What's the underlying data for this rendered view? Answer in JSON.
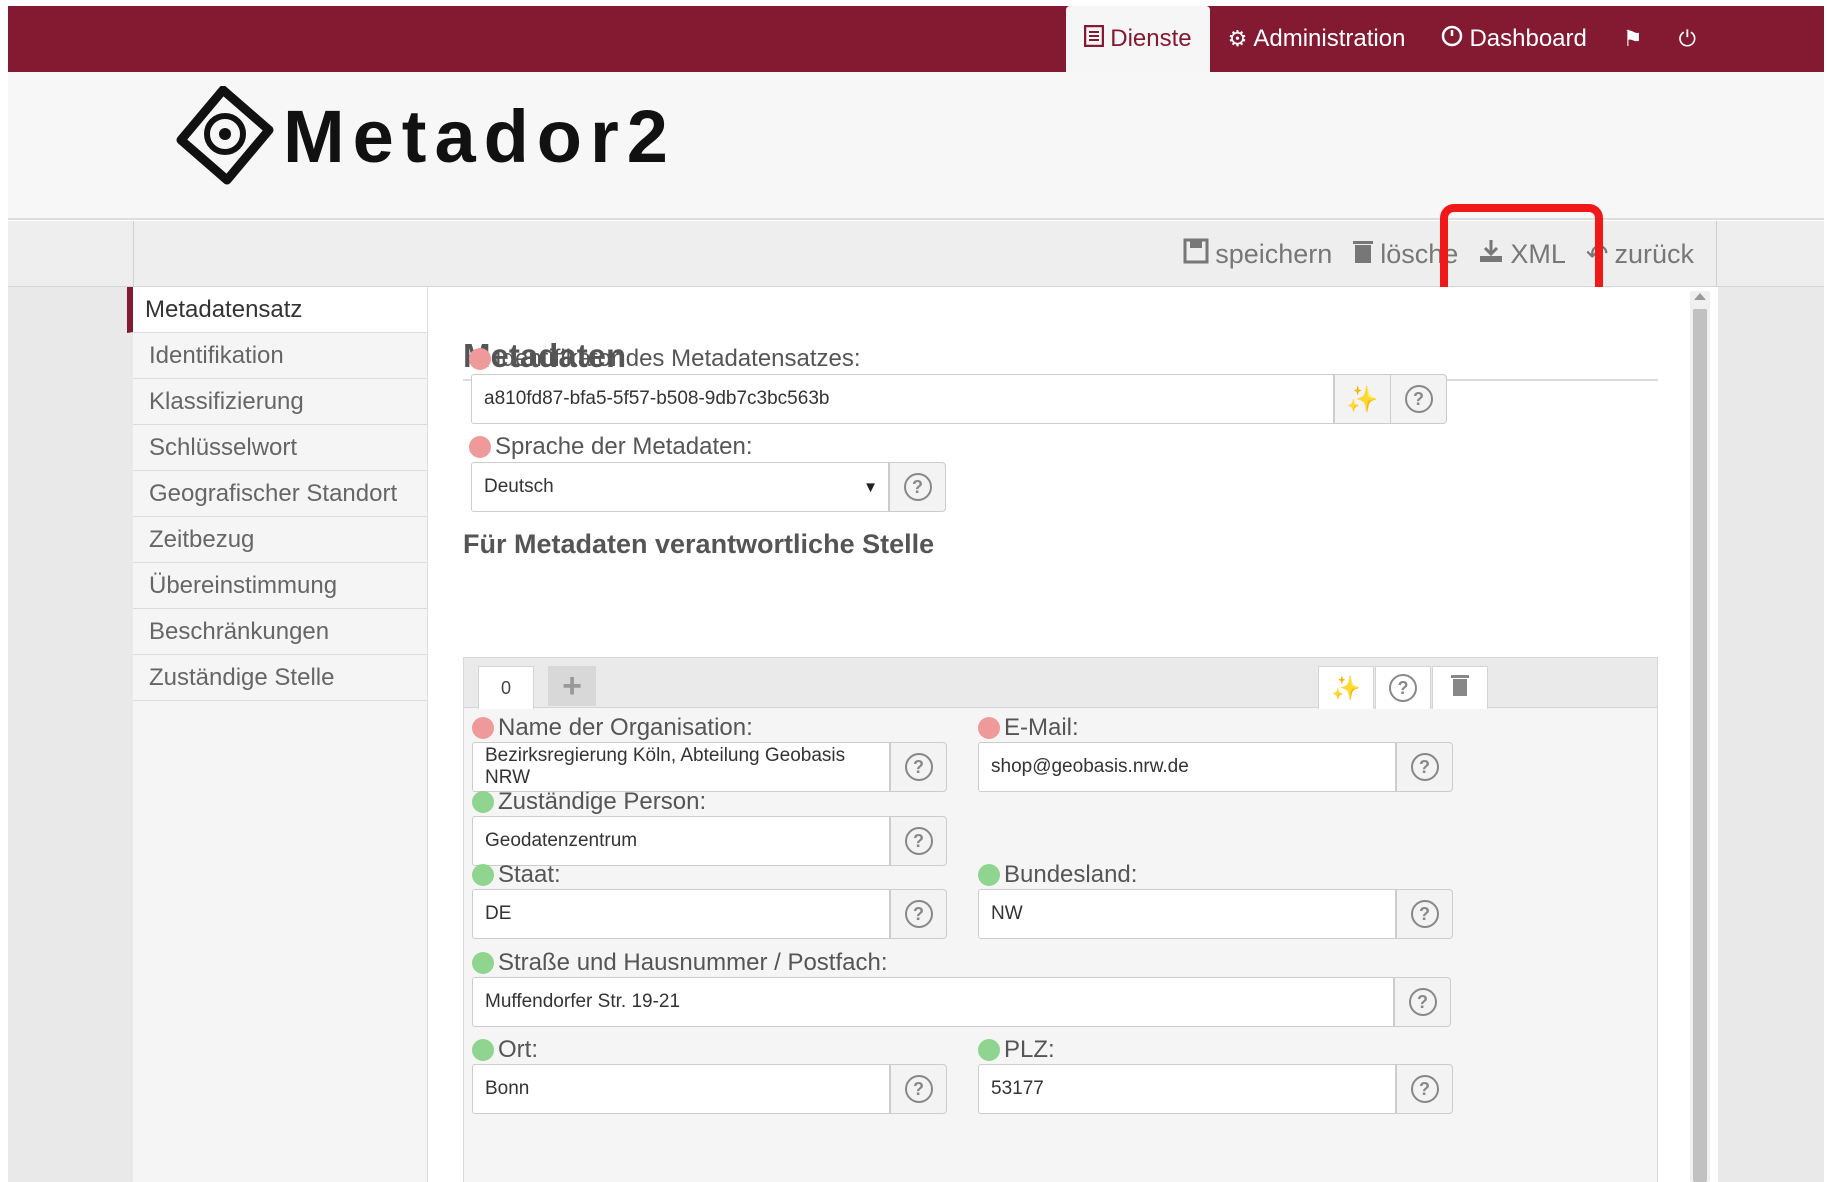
{
  "nav": {
    "items": [
      {
        "icon": "list-icon",
        "label": "Dienste"
      },
      {
        "icon": "gear-icon",
        "label": "Administration"
      },
      {
        "icon": "dashboard-icon",
        "label": "Dashboard"
      }
    ],
    "flag_icon": "flag-icon",
    "power_icon": "power-icon"
  },
  "header": {
    "logo_text": "Metador2"
  },
  "toolbar": {
    "save_label": "speichern",
    "delete_label": "lösche",
    "xml_label": "XML",
    "back_label": "zurück"
  },
  "sidebar": {
    "items": [
      {
        "label": "Metadatensatz"
      },
      {
        "label": "Identifikation"
      },
      {
        "label": "Klassifizierung"
      },
      {
        "label": "Schlüsselwort"
      },
      {
        "label": "Geografischer Standort"
      },
      {
        "label": "Zeitbezug"
      },
      {
        "label": "Übereinstimmung"
      },
      {
        "label": "Beschränkungen"
      },
      {
        "label": "Zuständige Stelle"
      }
    ]
  },
  "main": {
    "title": "Metadaten",
    "identifier_label": "Identifikator des Metadatensatzes:",
    "identifier_value": "a810fd87-bfa5-5f57-b508-9db7c3bc563b",
    "language_label": "Sprache der Metadaten:",
    "language_value": "Deutsch",
    "section_title": "Für Metadaten verantwortliche Stelle",
    "tab_label": "0",
    "fields": {
      "org_label": "Name der Organisation:",
      "org_value": "Bezirksregierung Köln, Abteilung Geobasis NRW",
      "email_label": "E-Mail:",
      "email_value": "shop@geobasis.nrw.de",
      "person_label": "Zuständige Person:",
      "person_value": "Geodatenzentrum",
      "country_label": "Staat:",
      "country_value": "DE",
      "state_label": "Bundesland:",
      "state_value": "NW",
      "street_label": "Straße und Hausnummer / Postfach:",
      "street_value": "Muffendorfer Str. 19-21",
      "city_label": "Ort:",
      "city_value": "Bonn",
      "zip_label": "PLZ:",
      "zip_value": "53177"
    }
  },
  "colors": {
    "brand": "#841a32",
    "highlight": "#f01818",
    "required": "#ef9a9a",
    "optional": "#8fd48f"
  }
}
